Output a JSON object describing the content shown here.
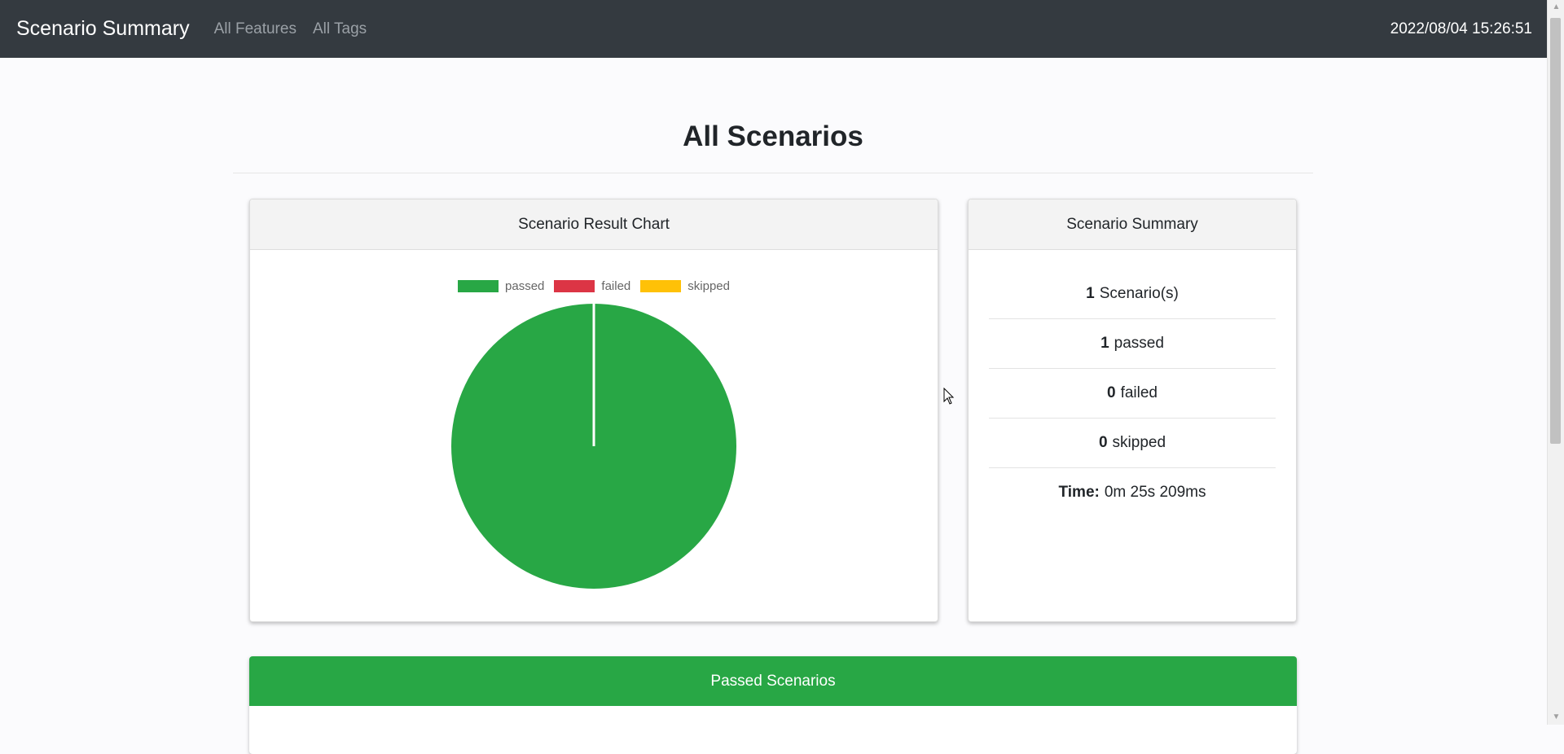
{
  "navbar": {
    "brand": "Scenario Summary",
    "links": [
      "All Features",
      "All Tags"
    ],
    "timestamp": "2022/08/04 15:26:51"
  },
  "page": {
    "title": "All Scenarios"
  },
  "chart_card": {
    "header": "Scenario Result Chart"
  },
  "summary_card": {
    "header": "Scenario Summary",
    "rows": [
      {
        "value": "1",
        "label": "Scenario(s)"
      },
      {
        "value": "1",
        "label": "passed"
      },
      {
        "value": "0",
        "label": "failed"
      },
      {
        "value": "0",
        "label": "skipped"
      },
      {
        "value": "Time:",
        "label": "0m 25s 209ms"
      }
    ]
  },
  "passed_section": {
    "header": "Passed Scenarios"
  },
  "colors": {
    "passed": "#28a745",
    "failed": "#dc3545",
    "skipped": "#ffc107",
    "navbar": "#343a40"
  },
  "chart_data": {
    "type": "pie",
    "categories": [
      "passed",
      "failed",
      "skipped"
    ],
    "values": [
      1,
      0,
      0
    ],
    "colors": [
      "#28a745",
      "#dc3545",
      "#ffc107"
    ],
    "legend_position": "top"
  }
}
